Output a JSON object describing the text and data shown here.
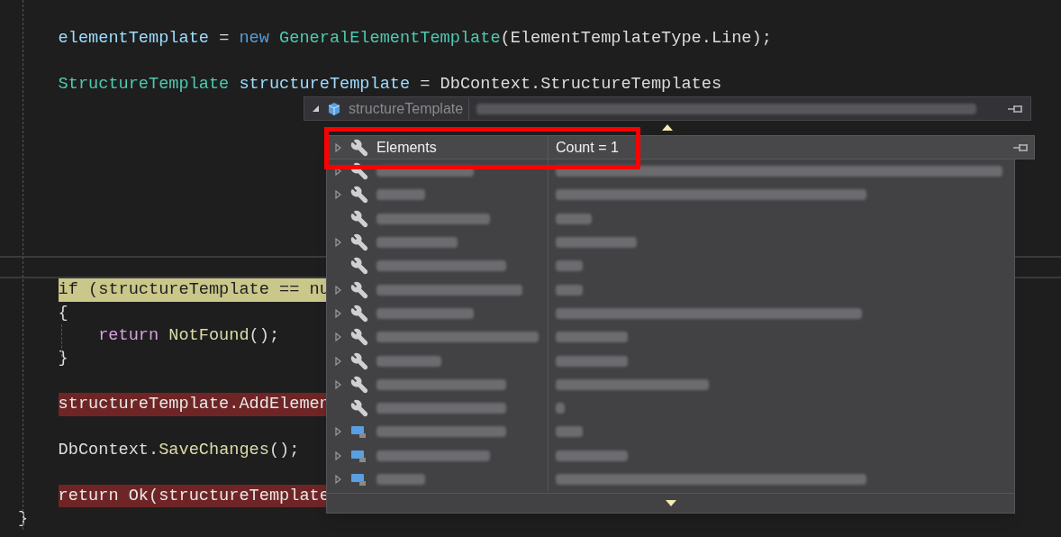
{
  "editor": {
    "lines": [
      {
        "kind": "block",
        "children": [
          {
            "kind": "code",
            "tokens": [
              {
                "text": "elementTemplate",
                "kind": "variable"
              },
              {
                "text": " = ",
                "kind": "plain"
              },
              {
                "text": "new ",
                "kind": "keyword"
              },
              {
                "text": "GeneralElementTemplate",
                "kind": "type"
              },
              {
                "text": "(ElementTemplateType.Line);",
                "kind": "plain"
              }
            ]
          },
          {
            "kind": "blank"
          },
          {
            "kind": "code",
            "tokens": [
              {
                "text": "StructureTemplate ",
                "kind": "type"
              },
              {
                "text": "structureTemplate",
                "kind": "variable"
              },
              {
                "text": " = DbContext.StructureTemplates",
                "kind": "plain"
              }
            ]
          },
          {
            "kind": "blank"
          },
          {
            "kind": "blank"
          },
          {
            "kind": "blank"
          },
          {
            "kind": "blank"
          },
          {
            "kind": "blank"
          },
          {
            "kind": "blank"
          },
          {
            "kind": "blank"
          },
          {
            "kind": "divider"
          },
          {
            "kind": "current-statement",
            "tokens": [
              {
                "text": "if (structureTemplate == nu",
                "kind": "plain"
              }
            ]
          },
          {
            "kind": "code",
            "tokens": [
              {
                "text": "{",
                "kind": "plain"
              }
            ]
          },
          {
            "kind": "block",
            "children": [
              {
                "kind": "code",
                "tokens": [
                  {
                    "text": "return ",
                    "kind": "control"
                  },
                  {
                    "text": "NotFound",
                    "kind": "method"
                  },
                  {
                    "text": "();",
                    "kind": "plain"
                  }
                ]
              }
            ]
          },
          {
            "kind": "code",
            "tokens": [
              {
                "text": "}",
                "kind": "plain"
              }
            ]
          },
          {
            "kind": "blank"
          },
          {
            "kind": "breakpoint",
            "tokens": [
              {
                "text": "structureTemplate.AddElemen",
                "kind": "plain"
              }
            ]
          },
          {
            "kind": "blank"
          },
          {
            "kind": "code",
            "tokens": [
              {
                "text": "DbContext.",
                "kind": "plain"
              },
              {
                "text": "SaveChanges",
                "kind": "method"
              },
              {
                "text": "();",
                "kind": "plain"
              }
            ]
          },
          {
            "kind": "blank"
          },
          {
            "kind": "breakpoint",
            "tokens": [
              {
                "text": "return Ok(structureTemplate",
                "kind": "plain"
              }
            ]
          }
        ]
      },
      {
        "kind": "code",
        "tokens": [
          {
            "text": "}",
            "kind": "plain"
          }
        ]
      }
    ]
  },
  "datatip": {
    "expanded": true,
    "name": "structureTemplate",
    "value_redacted": true,
    "members": [
      {
        "kind": "property",
        "expandable": true,
        "highlighted": true,
        "name": "Elements",
        "value": "Count = 1"
      },
      {
        "kind": "property",
        "expandable": true,
        "highlighted": false
      },
      {
        "kind": "property",
        "expandable": true,
        "highlighted": false
      },
      {
        "kind": "property",
        "expandable": false,
        "highlighted": false
      },
      {
        "kind": "property",
        "expandable": true,
        "highlighted": false
      },
      {
        "kind": "property",
        "expandable": false,
        "highlighted": false
      },
      {
        "kind": "property",
        "expandable": true,
        "highlighted": false
      },
      {
        "kind": "property",
        "expandable": true,
        "highlighted": false
      },
      {
        "kind": "property",
        "expandable": true,
        "highlighted": false
      },
      {
        "kind": "property",
        "expandable": true,
        "highlighted": false
      },
      {
        "kind": "property",
        "expandable": true,
        "highlighted": false
      },
      {
        "kind": "property",
        "expandable": false,
        "highlighted": false
      },
      {
        "kind": "field",
        "expandable": true,
        "highlighted": false
      },
      {
        "kind": "field",
        "expandable": true,
        "highlighted": false
      },
      {
        "kind": "field",
        "expandable": true,
        "highlighted": false
      }
    ]
  }
}
